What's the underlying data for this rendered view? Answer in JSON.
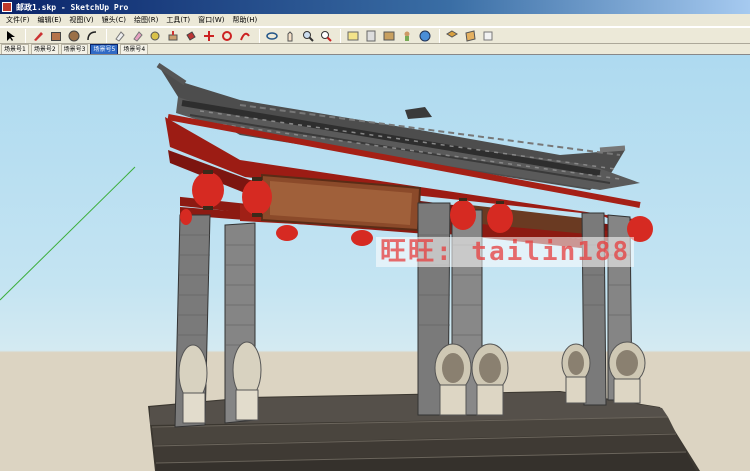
{
  "window": {
    "title": "邮政1.skp - SketchUp Pro"
  },
  "menu": [
    {
      "label": "文件(F)"
    },
    {
      "label": "编辑(E)"
    },
    {
      "label": "视图(V)"
    },
    {
      "label": "镜头(C)"
    },
    {
      "label": "绘图(R)"
    },
    {
      "label": "工具(T)"
    },
    {
      "label": "窗口(W)"
    },
    {
      "label": "帮助(H)"
    }
  ],
  "toolbar": {
    "tools": [
      {
        "icon": "select-arrow-icon"
      },
      {
        "icon": "pencil-line-icon"
      },
      {
        "icon": "rectangle-icon"
      },
      {
        "icon": "circle-icon"
      },
      {
        "icon": "arc-icon"
      },
      {
        "icon": "eraser-icon"
      },
      {
        "icon": "eraser-icon-2"
      },
      {
        "icon": "tape-measure-icon"
      },
      {
        "icon": "push-pull-icon"
      },
      {
        "icon": "paint-bucket-icon"
      },
      {
        "icon": "move-icon"
      },
      {
        "icon": "rotate-icon"
      },
      {
        "icon": "follow-me-icon"
      },
      {
        "icon": "orbit-icon"
      },
      {
        "icon": "pan-icon"
      },
      {
        "icon": "zoom-icon"
      },
      {
        "icon": "zoom-extents-icon"
      },
      {
        "icon": "walk-icon"
      },
      {
        "icon": "section-icon"
      },
      {
        "icon": "position-camera-icon"
      },
      {
        "icon": "look-around-icon"
      },
      {
        "icon": "geo-location-icon"
      },
      {
        "icon": "components-icon"
      },
      {
        "icon": "materials-icon"
      },
      {
        "icon": "styles-icon"
      }
    ]
  },
  "scenes": [
    {
      "label": "场景号1",
      "active": false
    },
    {
      "label": "场景号2",
      "active": false
    },
    {
      "label": "场景号3",
      "active": false
    },
    {
      "label": "场景号5",
      "active": true
    },
    {
      "label": "场景号4",
      "active": false
    }
  ],
  "watermark": "旺旺: tailin188",
  "colors": {
    "sky_top": "#aedaf0",
    "ground": "#dcd4c2",
    "roof_tile": "#5a5a5a",
    "timber_red": "#9c1c14",
    "pillar_gray": "#7a7a7a",
    "lantern_red": "#d62a22",
    "plaque_brown": "#8b4a2a",
    "steps_dark": "#3a3630",
    "watermark_red": "#e63c3c"
  }
}
